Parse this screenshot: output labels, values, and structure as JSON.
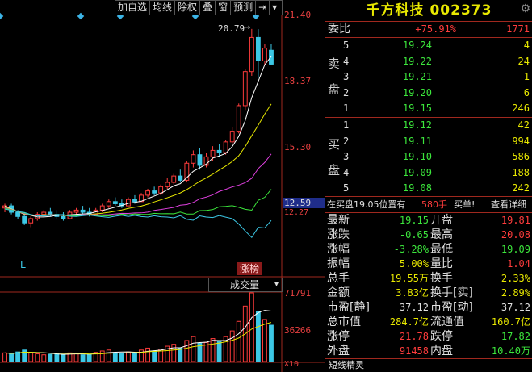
{
  "toolbar": {
    "items": [
      "加自选",
      "均线",
      "除权",
      "叠",
      "窗",
      "预测"
    ],
    "nav_icon": "arrow-bar-right-icon",
    "dropdown_icon": "caret-down-icon"
  },
  "chart": {
    "price_labels": [
      "21.40",
      "18.37",
      "15.30",
      "12.59",
      "12.27"
    ],
    "current_price_tag": "12.59",
    "high_marker": "20.79",
    "low_marker": "L",
    "limit_tag": "涨榜",
    "volume_title": "成交量",
    "volume_labels": [
      "71791",
      "36266",
      "X10"
    ],
    "colors": {
      "up": "#ff3c3c",
      "down": "#3cc8e6",
      "ma1": "#ffffff",
      "ma2": "#e8e800",
      "ma3": "#e040e0",
      "ma4": "#3ce63c",
      "ma5": "#3cc8e6"
    }
  },
  "chart_data": {
    "type": "candlestick",
    "ylim": [
      10.8,
      21.4
    ],
    "candles": [
      {
        "o": 12.4,
        "h": 12.6,
        "l": 12.2,
        "c": 12.5
      },
      {
        "o": 12.5,
        "h": 12.6,
        "l": 12.1,
        "c": 12.2
      },
      {
        "o": 12.2,
        "h": 12.3,
        "l": 11.9,
        "c": 12.0
      },
      {
        "o": 12.0,
        "h": 12.2,
        "l": 11.6,
        "c": 11.7
      },
      {
        "o": 11.7,
        "h": 12.0,
        "l": 11.5,
        "c": 11.9
      },
      {
        "o": 11.9,
        "h": 12.2,
        "l": 11.8,
        "c": 12.1
      },
      {
        "o": 12.1,
        "h": 12.3,
        "l": 12.0,
        "c": 12.2
      },
      {
        "o": 12.2,
        "h": 12.4,
        "l": 12.0,
        "c": 12.1
      },
      {
        "o": 12.1,
        "h": 12.3,
        "l": 11.9,
        "c": 12.0
      },
      {
        "o": 12.0,
        "h": 12.2,
        "l": 11.8,
        "c": 11.9
      },
      {
        "o": 11.9,
        "h": 12.3,
        "l": 11.9,
        "c": 12.2
      },
      {
        "o": 12.2,
        "h": 12.4,
        "l": 12.1,
        "c": 12.3
      },
      {
        "o": 12.3,
        "h": 12.5,
        "l": 12.1,
        "c": 12.2
      },
      {
        "o": 12.2,
        "h": 12.4,
        "l": 12.0,
        "c": 12.1
      },
      {
        "o": 12.1,
        "h": 12.4,
        "l": 12.1,
        "c": 12.3
      },
      {
        "o": 12.3,
        "h": 12.6,
        "l": 12.2,
        "c": 12.5
      },
      {
        "o": 12.5,
        "h": 12.8,
        "l": 12.4,
        "c": 12.7
      },
      {
        "o": 12.7,
        "h": 12.9,
        "l": 12.5,
        "c": 12.6
      },
      {
        "o": 12.6,
        "h": 12.8,
        "l": 12.4,
        "c": 12.5
      },
      {
        "o": 12.5,
        "h": 12.9,
        "l": 12.5,
        "c": 12.8
      },
      {
        "o": 12.8,
        "h": 13.0,
        "l": 12.6,
        "c": 12.7
      },
      {
        "o": 12.7,
        "h": 13.1,
        "l": 12.7,
        "c": 13.0
      },
      {
        "o": 13.0,
        "h": 13.3,
        "l": 12.9,
        "c": 13.2
      },
      {
        "o": 13.2,
        "h": 13.4,
        "l": 13.0,
        "c": 13.1
      },
      {
        "o": 13.1,
        "h": 13.5,
        "l": 13.0,
        "c": 13.4
      },
      {
        "o": 13.4,
        "h": 13.8,
        "l": 13.3,
        "c": 13.6
      },
      {
        "o": 13.6,
        "h": 14.0,
        "l": 13.5,
        "c": 13.9
      },
      {
        "o": 13.9,
        "h": 14.2,
        "l": 13.6,
        "c": 13.7
      },
      {
        "o": 13.7,
        "h": 14.6,
        "l": 13.6,
        "c": 14.5
      },
      {
        "o": 14.5,
        "h": 15.1,
        "l": 14.3,
        "c": 14.9
      },
      {
        "o": 14.9,
        "h": 15.2,
        "l": 14.2,
        "c": 14.4
      },
      {
        "o": 14.4,
        "h": 15.0,
        "l": 14.3,
        "c": 14.8
      },
      {
        "o": 14.8,
        "h": 15.3,
        "l": 14.6,
        "c": 15.1
      },
      {
        "o": 15.1,
        "h": 15.4,
        "l": 14.8,
        "c": 15.0
      },
      {
        "o": 15.0,
        "h": 15.6,
        "l": 14.9,
        "c": 15.5
      },
      {
        "o": 15.5,
        "h": 16.2,
        "l": 15.4,
        "c": 16.0
      },
      {
        "o": 16.0,
        "h": 17.3,
        "l": 15.9,
        "c": 17.2
      },
      {
        "o": 17.2,
        "h": 18.9,
        "l": 17.0,
        "c": 18.8
      },
      {
        "o": 18.8,
        "h": 20.8,
        "l": 18.6,
        "c": 20.4
      },
      {
        "o": 20.4,
        "h": 20.79,
        "l": 18.5,
        "c": 19.3
      },
      {
        "o": 19.3,
        "h": 20.1,
        "l": 19.1,
        "c": 19.9
      },
      {
        "o": 19.8,
        "h": 20.1,
        "l": 19.1,
        "c": 19.15
      }
    ],
    "volumes": [
      9000,
      8000,
      10000,
      12000,
      9000,
      8000,
      7000,
      7500,
      8000,
      7000,
      9000,
      8500,
      7000,
      7200,
      9500,
      11000,
      12000,
      9000,
      8000,
      10000,
      9500,
      12000,
      14000,
      11000,
      13000,
      16000,
      18000,
      14000,
      22000,
      26000,
      19000,
      20000,
      24000,
      21000,
      26000,
      32000,
      42000,
      58000,
      71791,
      52000,
      44000,
      38000
    ]
  },
  "panel": {
    "title": "千方科技 002373",
    "weibi_label": "委比",
    "weibi_pct": "+75.91%",
    "weibi_val": "1771",
    "sell_label": [
      "卖",
      "盘"
    ],
    "buy_label": [
      "买",
      "盘"
    ],
    "asks": [
      {
        "lvl": "5",
        "price": "19.24",
        "vol": "4"
      },
      {
        "lvl": "4",
        "price": "19.22",
        "vol": "24"
      },
      {
        "lvl": "3",
        "price": "19.21",
        "vol": "1"
      },
      {
        "lvl": "2",
        "price": "19.20",
        "vol": "6"
      },
      {
        "lvl": "1",
        "price": "19.15",
        "vol": "246"
      }
    ],
    "bids": [
      {
        "lvl": "1",
        "price": "19.12",
        "vol": "42"
      },
      {
        "lvl": "2",
        "price": "19.11",
        "vol": "994"
      },
      {
        "lvl": "3",
        "price": "19.10",
        "vol": "586"
      },
      {
        "lvl": "4",
        "price": "19.09",
        "vol": "188"
      },
      {
        "lvl": "5",
        "price": "19.08",
        "vol": "242"
      }
    ],
    "ticker": {
      "text": "在买盘19.05位置有",
      "qty": "580手",
      "action": "买单!",
      "detail": "查看详细"
    },
    "stats": [
      {
        "l1": "最新",
        "v1": "19.15",
        "c1": "g",
        "l2": "开盘",
        "v2": "19.81",
        "c2": "r"
      },
      {
        "l1": "涨跌",
        "v1": "-0.65",
        "c1": "g",
        "l2": "最高",
        "v2": "20.08",
        "c2": "r"
      },
      {
        "l1": "涨幅",
        "v1": "-3.28%",
        "c1": "g",
        "l2": "最低",
        "v2": "19.09",
        "c2": "g"
      },
      {
        "l1": "振幅",
        "v1": "5.00%",
        "c1": "y",
        "l2": "量比",
        "v2": "1.04",
        "c2": "r"
      },
      {
        "l1": "总手",
        "v1": "19.55万",
        "c1": "y",
        "l2": "换手",
        "v2": "2.33%",
        "c2": "y"
      },
      {
        "l1": "金额",
        "v1": "3.83亿",
        "c1": "y",
        "l2": "换手[实]",
        "v2": "2.89%",
        "c2": "y"
      },
      {
        "l1": "市盈[静]",
        "v1": "37.12",
        "c1": "w",
        "l2": "市盈[动]",
        "v2": "37.12",
        "c2": "w"
      },
      {
        "l1": "总市值",
        "v1": "284.7亿",
        "c1": "y",
        "l2": "流通值",
        "v2": "160.7亿",
        "c2": "y"
      },
      {
        "l1": "涨停",
        "v1": "21.78",
        "c1": "r",
        "l2": "跌停",
        "v2": "17.82",
        "c2": "g"
      },
      {
        "l1": "外盘",
        "v1": "91458",
        "c1": "r",
        "l2": "内盘",
        "v2": "10.40万",
        "c2": "g"
      }
    ],
    "footer": "短线精灵"
  }
}
